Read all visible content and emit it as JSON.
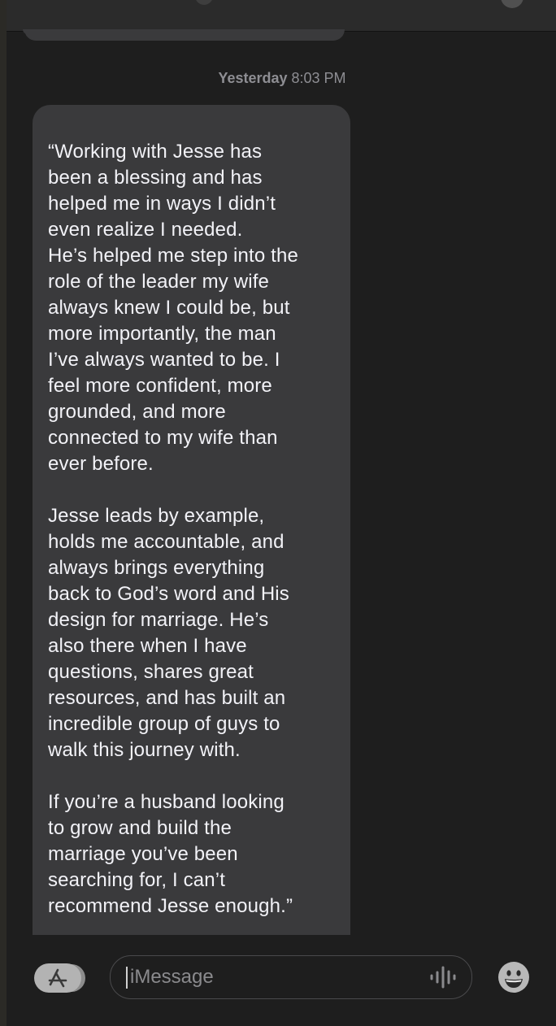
{
  "thread": {
    "timestamp_day": "Yesterday",
    "timestamp_time": "8:03 PM",
    "message": {
      "paragraphs": [
        "“Working with Jesse has\nbeen a blessing and has\nhelped me in ways I didn’t\neven realize I needed.\nHe’s helped me step into the\nrole of the leader my wife\nalways knew I could be, but\nmore importantly, the man\nI’ve always wanted to be. I\nfeel more confident, more\ngrounded, and more\nconnected to my wife than\never before.",
        "Jesse leads by example,\nholds me accountable, and\nalways brings everything\nback to God’s word and His\ndesign for marriage. He’s\nalso there when I have\nquestions, shares great\nresources, and has built an\nincredible group of guys to\nwalk this journey with.",
        "If you’re a husband looking\nto grow and build the\nmarriage you’ve been\nsearching for, I can’t\nrecommend Jesse enough.”"
      ]
    }
  },
  "composer": {
    "placeholder": "iMessage",
    "value": "",
    "icons": {
      "apps": "app-store-icon",
      "audio": "audio-waveform-icon",
      "emoji": "emoji-icon"
    }
  },
  "colors": {
    "background": "#1e1e1e",
    "bubble": "#3a3a3c",
    "text": "#f2f2f7",
    "timestamp": "#8e8e93"
  }
}
